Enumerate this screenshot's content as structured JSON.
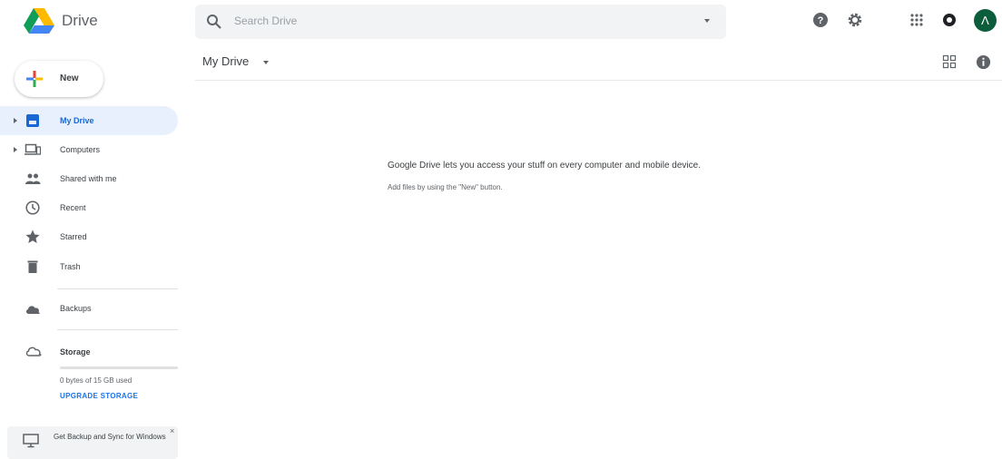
{
  "header": {
    "app_name": "Drive",
    "search_placeholder": "Search Drive",
    "avatar_letter": "Λ"
  },
  "sidebar": {
    "new_label": "New",
    "items": [
      {
        "label": "My Drive",
        "icon": "my-drive-icon",
        "active": true
      },
      {
        "label": "Computers",
        "icon": "computers-icon"
      },
      {
        "label": "Shared with me",
        "icon": "shared-icon"
      },
      {
        "label": "Recent",
        "icon": "clock-icon"
      },
      {
        "label": "Starred",
        "icon": "star-icon"
      },
      {
        "label": "Trash",
        "icon": "trash-icon"
      },
      {
        "label": "Backups",
        "icon": "cloud-icon"
      }
    ],
    "storage": {
      "label": "Storage",
      "used_text": "0 bytes of 15 GB used",
      "upgrade_label": "UPGRADE STORAGE"
    },
    "promo": {
      "label": "Get Backup and Sync for Windows",
      "close": "×"
    }
  },
  "main": {
    "breadcrumb": "My Drive",
    "empty_title": "Google Drive lets you access your stuff on every computer and mobile device.",
    "empty_subtitle": "Add files by using the \"New\" button."
  },
  "colors": {
    "accent": "#1a73e8",
    "active_bg": "#e8f0fe",
    "search_bg": "#f1f3f4",
    "avatar_bg": "#0b5d3c"
  }
}
